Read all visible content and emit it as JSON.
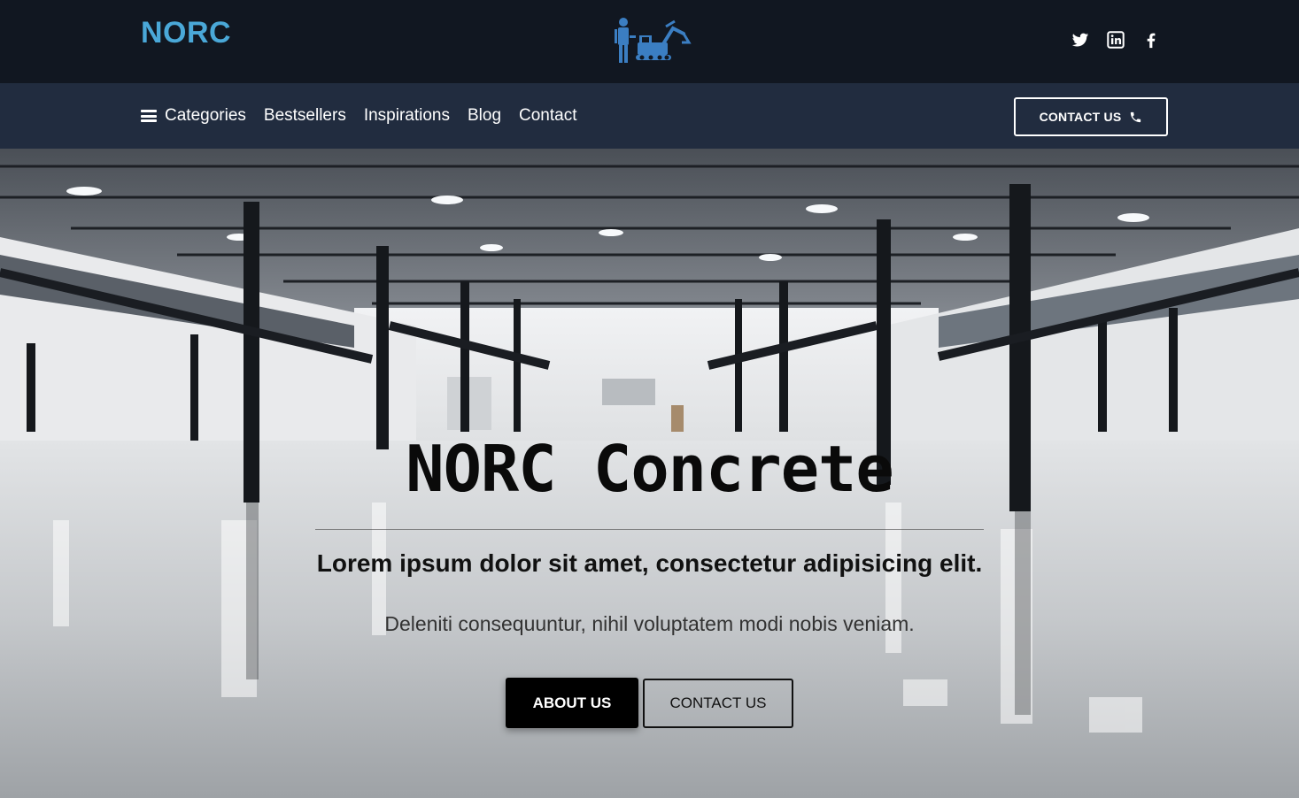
{
  "header": {
    "brand": "NORC",
    "logo_icon": "worker-excavator-logo-icon",
    "social": [
      {
        "name": "twitter-icon"
      },
      {
        "name": "linkedin-icon"
      },
      {
        "name": "facebook-icon"
      }
    ]
  },
  "nav": {
    "items": [
      {
        "label": "Categories",
        "icon": "hamburger-icon"
      },
      {
        "label": "Bestsellers"
      },
      {
        "label": "Inspirations"
      },
      {
        "label": "Blog"
      },
      {
        "label": "Contact"
      }
    ],
    "cta_label": "CONTACT US",
    "cta_icon": "phone-icon"
  },
  "hero": {
    "title": "NORC Concrete",
    "subtitle": "Lorem ipsum dolor sit amet, consectetur adipisicing elit.",
    "description": "Deleniti consequuntur, nihil voluptatem modi nobis veniam.",
    "primary_button": "ABOUT US",
    "secondary_button": "CONTACT US",
    "background": "warehouse-interior-image"
  },
  "colors": {
    "brand": "#4aa8d8",
    "topbar": "#111721",
    "navbar": "#212c3f",
    "logo": "#3b7ec2"
  }
}
